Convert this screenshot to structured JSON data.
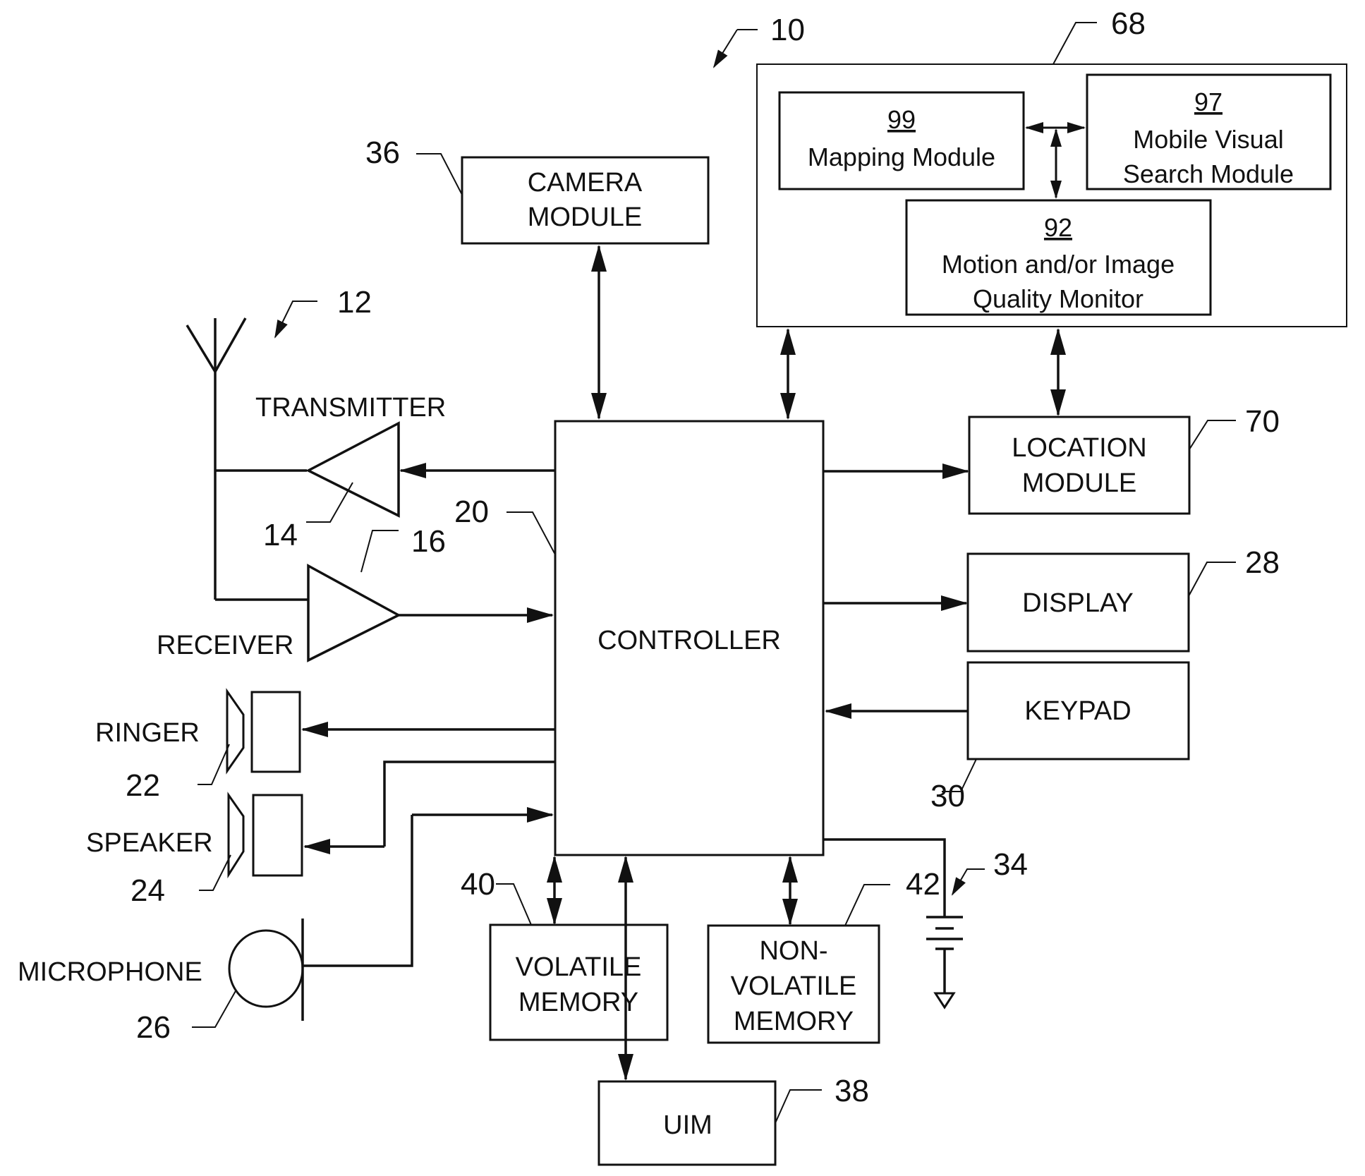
{
  "diagram": {
    "device_ref": "10",
    "blocks": {
      "camera": {
        "ref": "36",
        "lines": [
          "CAMERA",
          "MODULE"
        ]
      },
      "controller": {
        "ref": "20",
        "lines": [
          "CONTROLLER"
        ]
      },
      "apparatus": {
        "ref": "68"
      },
      "mapping": {
        "ref": "99",
        "lines": [
          "Mapping Module"
        ]
      },
      "mvs": {
        "ref": "97",
        "lines": [
          "Mobile Visual",
          "Search Module"
        ]
      },
      "monitor": {
        "ref": "92",
        "lines": [
          "Motion and/or Image",
          "Quality Monitor"
        ]
      },
      "location": {
        "ref": "70",
        "lines": [
          "LOCATION",
          "MODULE"
        ]
      },
      "display": {
        "ref": "28",
        "lines": [
          "DISPLAY"
        ]
      },
      "keypad": {
        "ref": "30",
        "lines": [
          "KEYPAD"
        ]
      },
      "volatile": {
        "ref": "40",
        "lines": [
          "VOLATILE",
          "MEMORY"
        ]
      },
      "nonvolatile": {
        "ref": "42",
        "lines": [
          "NON-",
          "VOLATILE",
          "MEMORY"
        ]
      },
      "uim": {
        "ref": "38",
        "lines": [
          "UIM"
        ]
      }
    },
    "components": {
      "antenna": {
        "ref": "12"
      },
      "transmitter": {
        "ref": "14",
        "label": "TRANSMITTER"
      },
      "receiver": {
        "ref": "16",
        "label": "RECEIVER"
      },
      "ringer": {
        "ref": "22",
        "label": "RINGER"
      },
      "speaker": {
        "ref": "24",
        "label": "SPEAKER"
      },
      "microphone": {
        "ref": "26",
        "label": "MICROPHONE"
      },
      "battery": {
        "ref": "34"
      }
    }
  }
}
